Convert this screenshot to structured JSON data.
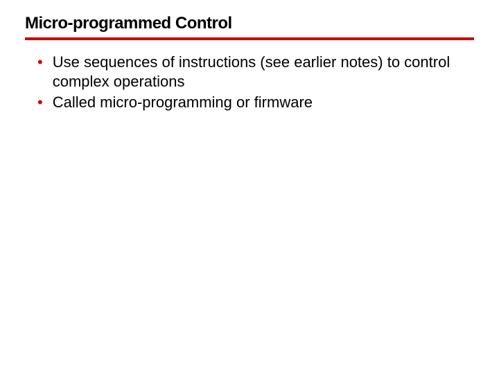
{
  "title": "Micro-programmed Control",
  "bullets": [
    "Use sequences of instructions (see earlier notes) to control complex operations",
    "Called micro-programming or firmware"
  ]
}
